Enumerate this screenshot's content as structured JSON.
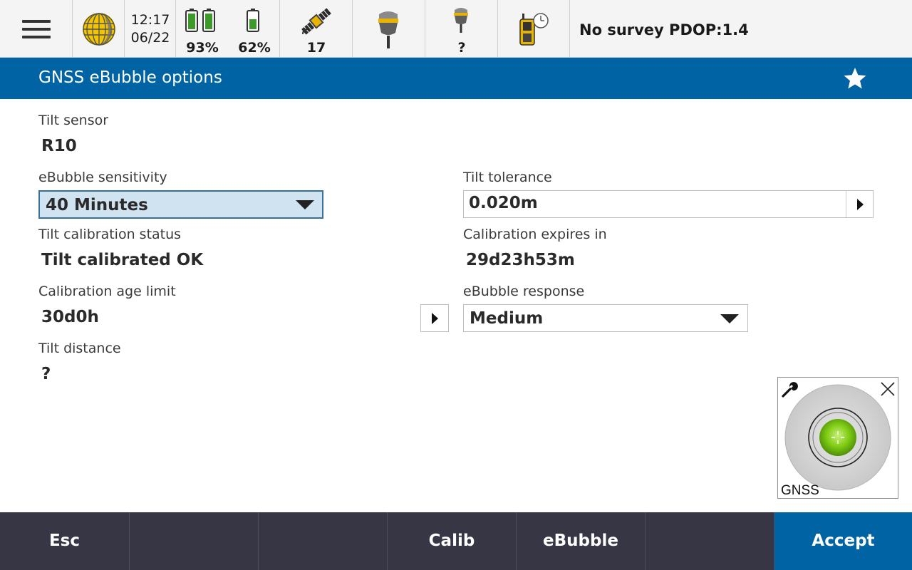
{
  "status_bar": {
    "time": "12:17",
    "date": "06/22",
    "battery_1_percent": "93%",
    "battery_2_percent": "62%",
    "satellites": "17",
    "receiver_2_status": "?",
    "survey_status": "No survey  PDOP:1.4"
  },
  "title_bar": {
    "title": "GNSS eBubble options"
  },
  "form": {
    "tilt_sensor": {
      "label": "Tilt sensor",
      "value": "R10"
    },
    "ebubble_sensitivity": {
      "label": "eBubble sensitivity",
      "value": "40 Minutes"
    },
    "tilt_tolerance": {
      "label": "Tilt tolerance",
      "value": "0.020m"
    },
    "tilt_calibration_status": {
      "label": "Tilt calibration status",
      "value": "Tilt calibrated OK"
    },
    "calibration_expires_in": {
      "label": "Calibration expires in",
      "value": "29d23h53m"
    },
    "calibration_age_limit": {
      "label": "Calibration age limit",
      "value": "30d0h"
    },
    "ebubble_response": {
      "label": "eBubble response",
      "value": "Medium"
    },
    "tilt_distance": {
      "label": "Tilt distance",
      "value": "?"
    }
  },
  "ebubble_widget": {
    "label": "GNSS"
  },
  "bottom_bar": {
    "esc": "Esc",
    "empty_1": "",
    "empty_2": "",
    "calib": "Calib",
    "ebubble": "eBubble",
    "empty_3": "",
    "accept": "Accept"
  },
  "colors": {
    "title_bar": "#0063a3",
    "bottom_bar": "#363645",
    "accept_button": "#0063a3",
    "dropdown_active": "#cfe3f0",
    "bubble_green": "#7fcc14"
  },
  "icons": {
    "menu": "hamburger-menu-icon",
    "globe": "globe-icon",
    "battery": "battery-icon",
    "satellite": "satellite-icon",
    "receiver": "gnss-receiver-icon",
    "controller": "controller-clock-icon",
    "favorite": "star-icon",
    "settings": "wrench-icon",
    "close": "close-icon"
  }
}
